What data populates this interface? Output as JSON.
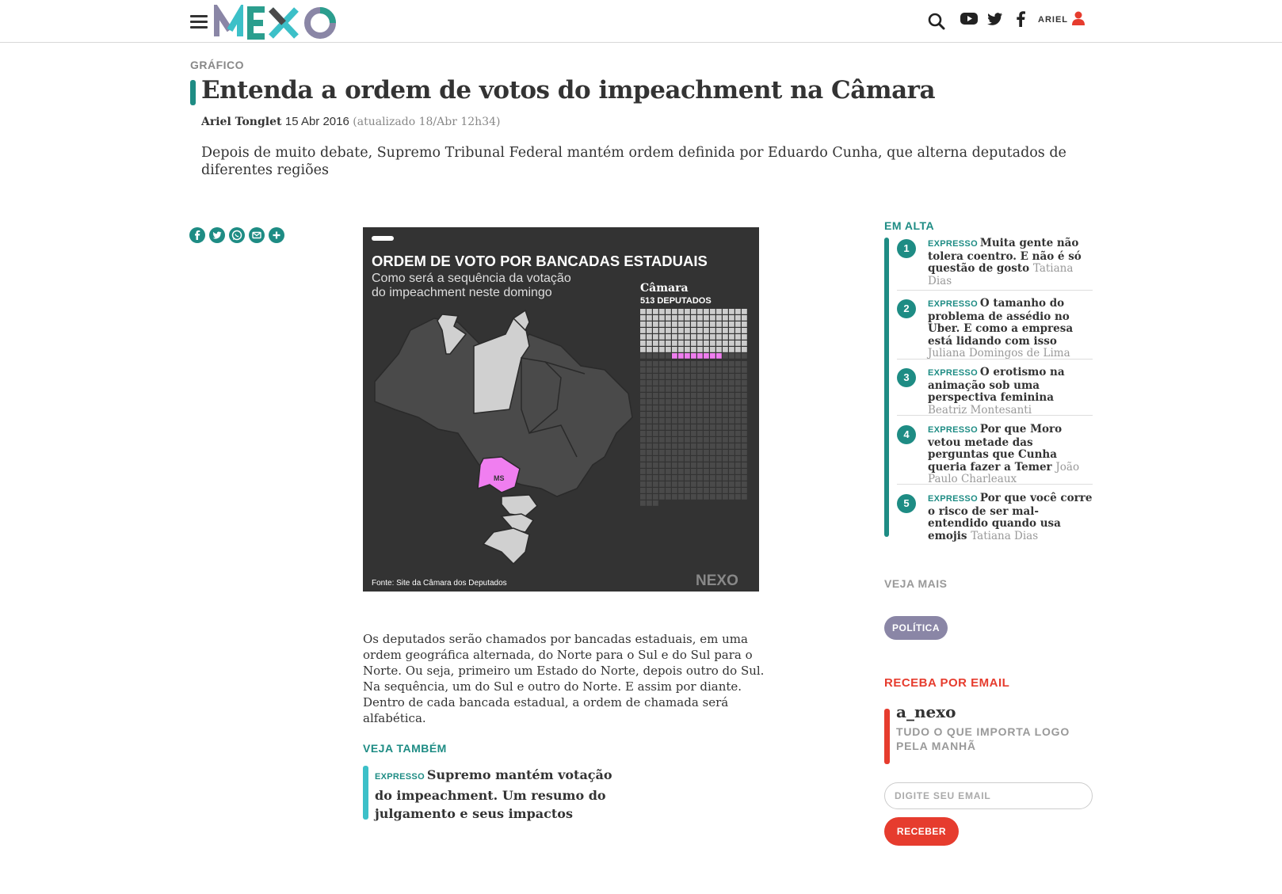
{
  "header": {
    "logo_text": "NEXO",
    "user_label": "ARIEL",
    "icons": [
      "menu-icon",
      "search-icon",
      "youtube-icon",
      "twitter-icon",
      "facebook-icon",
      "user-icon"
    ]
  },
  "article": {
    "kicker": "GRÁFICO",
    "title": "Entenda a ordem de votos do impeachment na Câmara",
    "author": "Ariel Tonglet",
    "date": "15 Abr 2016",
    "updated": "(atualizado 18/Abr 12h34)",
    "lede": "Depois de muito debate, Supremo Tribunal Federal mantém ordem definida por Eduardo Cunha, que alterna deputados de diferentes regiões",
    "share_icons": [
      "facebook-icon",
      "twitter-icon",
      "whatsapp-icon",
      "email-icon",
      "plus-icon"
    ],
    "body": "Os deputados serão chamados por bancadas estaduais, em uma ordem geográfica alternada, do Norte para o Sul e do Sul para o Norte. Ou seja, primeiro um Estado do Norte, depois outro do Sul. Na sequência, um do Sul e outro do Norte. E assim por diante. Dentro de cada bancada estadual, a ordem de chamada será alfabética."
  },
  "graphic": {
    "title": "ORDEM DE VOTO POR BANCADAS ESTADUAIS",
    "subtitle_1": "Como será a sequência da votação",
    "subtitle_2": "do impeachment neste domingo",
    "camara_label": "Câmara",
    "camara_count": "513 DEPUTADOS",
    "state_label": "MS",
    "source": "Fonte: Site da Câmara dos Deputados",
    "watermark": "NEXO",
    "colors": {
      "bg": "#333333",
      "voted": "#cccccc",
      "current": "#f07ef0",
      "pending": "#4a4a4a"
    }
  },
  "veja_tambem": {
    "heading": "VEJA TAMBÉM",
    "tag": "EXPRESSO",
    "title": "Supremo mantém votação do impeachment. Um resumo do julgamento e seus impactos"
  },
  "sidebar": {
    "em_alta_heading": "EM ALTA",
    "items": [
      {
        "num": "1",
        "tag": "EXPRESSO",
        "title": "Muita gente não tolera coentro. E não é só questão de gosto",
        "author": "Tatiana Dias"
      },
      {
        "num": "2",
        "tag": "EXPRESSO",
        "title": "O tamanho do problema de assédio no Uber. E como a empresa está lidando com isso",
        "author": "Juliana Domingos de Lima"
      },
      {
        "num": "3",
        "tag": "EXPRESSO",
        "title": "O erotismo na animação sob uma perspectiva feminina",
        "author": "Beatriz Montesanti"
      },
      {
        "num": "4",
        "tag": "EXPRESSO",
        "title": "Por que Moro vetou metade das perguntas que Cunha queria fazer a Temer",
        "author": "João Paulo Charleaux"
      },
      {
        "num": "5",
        "tag": "EXPRESSO",
        "title": "Por que você corre o risco de ser mal-entendido quando usa emojis",
        "author": "Tatiana Dias"
      }
    ],
    "veja_mais_heading": "VEJA MAIS",
    "tag_politica": "POLÍTICA",
    "receba_heading": "RECEBA POR EMAIL",
    "newsletter_title": "a_nexo",
    "newsletter_sub": "TUDO O QUE IMPORTA LOGO PELA MANHÃ",
    "email_placeholder": "DIGITE SEU EMAIL",
    "submit_label": "RECEBER"
  }
}
